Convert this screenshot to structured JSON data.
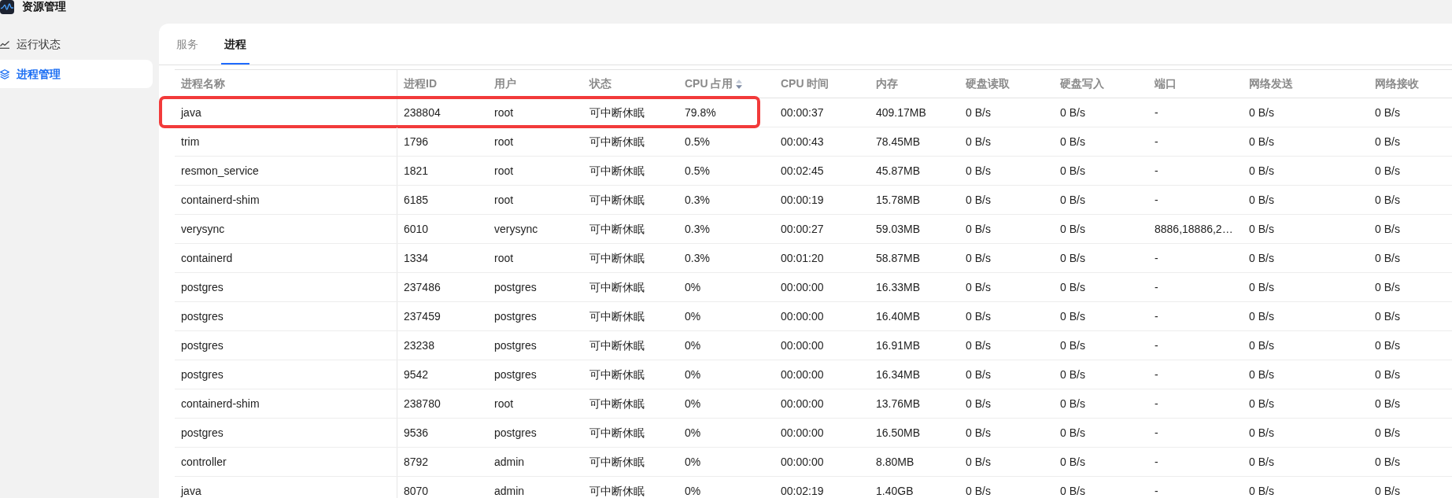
{
  "app": {
    "title": "资源管理"
  },
  "sidebar": {
    "items": [
      {
        "label": "运行状态",
        "selected": false
      },
      {
        "label": "进程管理",
        "selected": true
      }
    ]
  },
  "tabs": [
    {
      "label": "服务",
      "selected": false
    },
    {
      "label": "进程",
      "selected": true
    }
  ],
  "table": {
    "columns": [
      {
        "label": "进程名称",
        "sortable": false,
        "sorted_descending": false
      },
      {
        "label": "进程ID",
        "sortable": false,
        "sorted_descending": false
      },
      {
        "label": "用户",
        "sortable": false,
        "sorted_descending": false
      },
      {
        "label": "状态",
        "sortable": false,
        "sorted_descending": false
      },
      {
        "label": "CPU 占用",
        "sortable": true,
        "sorted_descending": true
      },
      {
        "label": "CPU 时间",
        "sortable": false,
        "sorted_descending": false
      },
      {
        "label": "内存",
        "sortable": false,
        "sorted_descending": false
      },
      {
        "label": "硬盘读取",
        "sortable": false,
        "sorted_descending": false
      },
      {
        "label": "硬盘写入",
        "sortable": false,
        "sorted_descending": false
      },
      {
        "label": "端口",
        "sortable": false,
        "sorted_descending": false
      },
      {
        "label": "网络发送",
        "sortable": false,
        "sorted_descending": false
      },
      {
        "label": "网络接收",
        "sortable": false,
        "sorted_descending": false
      }
    ],
    "rows": [
      {
        "highlighted": true,
        "cells": [
          "java",
          "238804",
          "root",
          "可中断休眠",
          "79.8%",
          "00:00:37",
          "409.17MB",
          "0 B/s",
          "0 B/s",
          "-",
          "0 B/s",
          "0 B/s"
        ]
      },
      {
        "highlighted": false,
        "cells": [
          "trim",
          "1796",
          "root",
          "可中断休眠",
          "0.5%",
          "00:00:43",
          "78.45MB",
          "0 B/s",
          "0 B/s",
          "-",
          "0 B/s",
          "0 B/s"
        ]
      },
      {
        "highlighted": false,
        "cells": [
          "resmon_service",
          "1821",
          "root",
          "可中断休眠",
          "0.5%",
          "00:02:45",
          "45.87MB",
          "0 B/s",
          "0 B/s",
          "-",
          "0 B/s",
          "0 B/s"
        ]
      },
      {
        "highlighted": false,
        "cells": [
          "containerd-shim",
          "6185",
          "root",
          "可中断休眠",
          "0.3%",
          "00:00:19",
          "15.78MB",
          "0 B/s",
          "0 B/s",
          "-",
          "0 B/s",
          "0 B/s"
        ]
      },
      {
        "highlighted": false,
        "cells": [
          "verysync",
          "6010",
          "verysync",
          "可中断休眠",
          "0.3%",
          "00:00:27",
          "59.03MB",
          "0 B/s",
          "0 B/s",
          "8886,18886,2…",
          "0 B/s",
          "0 B/s"
        ]
      },
      {
        "highlighted": false,
        "cells": [
          "containerd",
          "1334",
          "root",
          "可中断休眠",
          "0.3%",
          "00:01:20",
          "58.87MB",
          "0 B/s",
          "0 B/s",
          "-",
          "0 B/s",
          "0 B/s"
        ]
      },
      {
        "highlighted": false,
        "cells": [
          "postgres",
          "237486",
          "postgres",
          "可中断休眠",
          "0%",
          "00:00:00",
          "16.33MB",
          "0 B/s",
          "0 B/s",
          "-",
          "0 B/s",
          "0 B/s"
        ]
      },
      {
        "highlighted": false,
        "cells": [
          "postgres",
          "237459",
          "postgres",
          "可中断休眠",
          "0%",
          "00:00:00",
          "16.40MB",
          "0 B/s",
          "0 B/s",
          "-",
          "0 B/s",
          "0 B/s"
        ]
      },
      {
        "highlighted": false,
        "cells": [
          "postgres",
          "23238",
          "postgres",
          "可中断休眠",
          "0%",
          "00:00:00",
          "16.91MB",
          "0 B/s",
          "0 B/s",
          "-",
          "0 B/s",
          "0 B/s"
        ]
      },
      {
        "highlighted": false,
        "cells": [
          "postgres",
          "9542",
          "postgres",
          "可中断休眠",
          "0%",
          "00:00:00",
          "16.34MB",
          "0 B/s",
          "0 B/s",
          "-",
          "0 B/s",
          "0 B/s"
        ]
      },
      {
        "highlighted": false,
        "cells": [
          "containerd-shim",
          "238780",
          "root",
          "可中断休眠",
          "0%",
          "00:00:00",
          "13.76MB",
          "0 B/s",
          "0 B/s",
          "-",
          "0 B/s",
          "0 B/s"
        ]
      },
      {
        "highlighted": false,
        "cells": [
          "postgres",
          "9536",
          "postgres",
          "可中断休眠",
          "0%",
          "00:00:00",
          "16.50MB",
          "0 B/s",
          "0 B/s",
          "-",
          "0 B/s",
          "0 B/s"
        ]
      },
      {
        "highlighted": false,
        "cells": [
          "controller",
          "8792",
          "admin",
          "可中断休眠",
          "0%",
          "00:00:00",
          "8.80MB",
          "0 B/s",
          "0 B/s",
          "-",
          "0 B/s",
          "0 B/s"
        ]
      },
      {
        "highlighted": false,
        "cells": [
          "java",
          "8070",
          "admin",
          "可中断休眠",
          "0%",
          "00:02:19",
          "1.40GB",
          "0 B/s",
          "0 B/s",
          "-",
          "0 B/s",
          "0 B/s"
        ]
      }
    ]
  }
}
